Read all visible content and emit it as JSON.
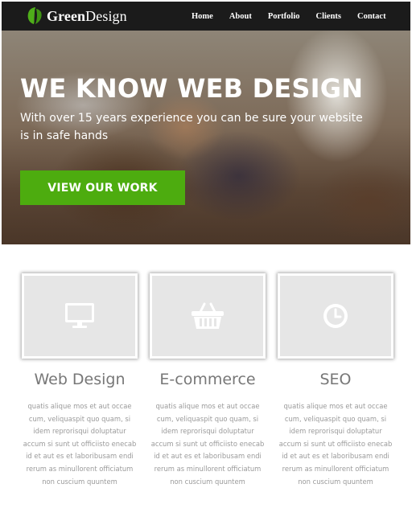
{
  "brand": {
    "logo_icon": "leaf-icon",
    "name_strong": "Green",
    "name_rest": "Design",
    "accent_color": "#4dac0f"
  },
  "nav": {
    "items": [
      {
        "label": "Home"
      },
      {
        "label": "About"
      },
      {
        "label": "Portfolio"
      },
      {
        "label": "Clients"
      },
      {
        "label": "Contact"
      }
    ]
  },
  "hero": {
    "title": "WE KNOW WEB DESIGN",
    "subtitle": "With over 15 years experience you can be sure your website is in safe hands",
    "button_label": "VIEW OUR WORK"
  },
  "services": [
    {
      "icon": "monitor-icon",
      "title": "Web Design",
      "description": "quatis alique mos et aut occae cum, veliquaspit quo quam, si idem reprorisqui doluptatur accum si sunt ut officiisto enecab id et aut es et laboribusam endi rerum as minullorent officiatum non cuscium quuntem"
    },
    {
      "icon": "shopping-basket-icon",
      "title": "E-commerce",
      "description": "quatis alique mos et aut occae cum, veliquaspit quo quam, si idem reprorisqui doluptatur accum si sunt ut officiisto enecab id et aut es et laboribusam endi rerum as minullorent officiatum non cuscium quuntem"
    },
    {
      "icon": "clock-icon",
      "title": "SEO",
      "description": "quatis alique mos et aut occae cum, veliquaspit quo quam, si idem reprorisqui doluptatur accum si sunt ut officiisto enecab id et aut es et laboribusam endi rerum as minullorent officiatum non cuscium quuntem"
    }
  ]
}
